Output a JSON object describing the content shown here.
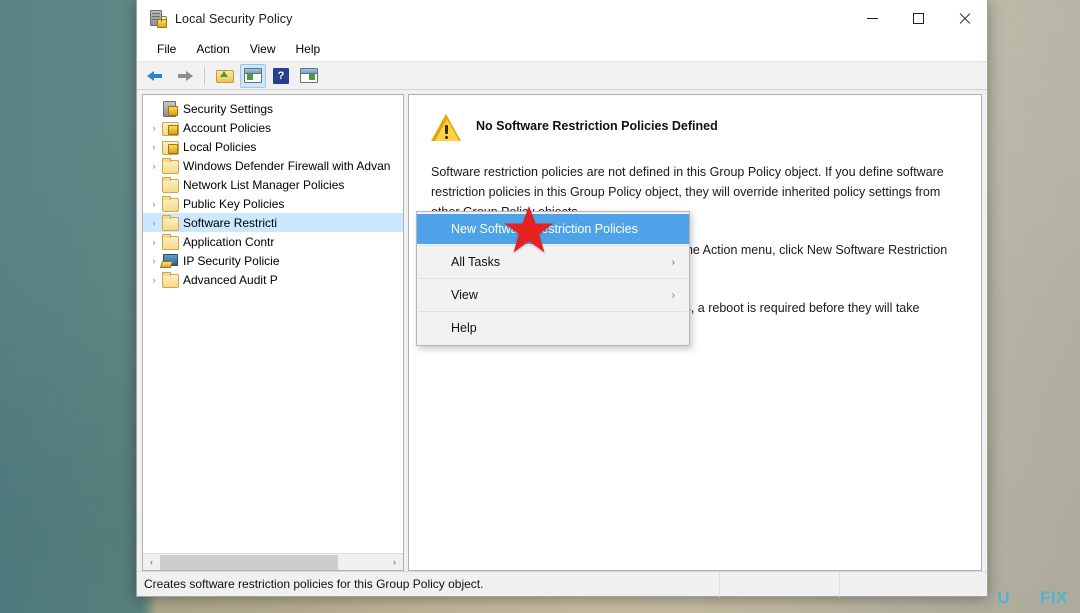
{
  "window": {
    "title": "Local Security Policy",
    "icon": "security-policy-icon",
    "controls": {
      "minimize": "—",
      "maximize": "□",
      "close": "✕"
    }
  },
  "menubar": {
    "items": [
      "File",
      "Action",
      "View",
      "Help"
    ]
  },
  "toolbar": {
    "buttons": [
      {
        "name": "back-button",
        "icon": "arrow-left-icon"
      },
      {
        "name": "forward-button",
        "icon": "arrow-right-icon"
      },
      {
        "name": "up-one-level-button",
        "icon": "folder-up-icon"
      },
      {
        "name": "show-hide-console-tree-button",
        "icon": "console-tree-icon",
        "active": true
      },
      {
        "name": "help-button",
        "icon": "question-mark-icon"
      },
      {
        "name": "show-hide-action-pane-button",
        "icon": "action-pane-icon"
      }
    ]
  },
  "tree": {
    "nodes": [
      {
        "label": "Security Settings",
        "icon": "security-settings-icon",
        "depth": 0,
        "expander": "none",
        "selected": false
      },
      {
        "label": "Account Policies",
        "icon": "folder-lock-icon",
        "depth": 1,
        "expander": "collapsed",
        "selected": false
      },
      {
        "label": "Local Policies",
        "icon": "folder-lock-icon",
        "depth": 1,
        "expander": "collapsed",
        "selected": false
      },
      {
        "label": "Windows Defender Firewall with Advan",
        "icon": "folder-icon",
        "depth": 1,
        "expander": "collapsed",
        "selected": false
      },
      {
        "label": "Network List Manager Policies",
        "icon": "folder-icon",
        "depth": 1,
        "expander": "none",
        "selected": false
      },
      {
        "label": "Public Key Policies",
        "icon": "folder-icon",
        "depth": 1,
        "expander": "collapsed",
        "selected": false
      },
      {
        "label": "Software Restricti",
        "icon": "folder-icon",
        "depth": 1,
        "expander": "collapsed",
        "selected": true
      },
      {
        "label": "Application Contr",
        "icon": "folder-icon",
        "depth": 1,
        "expander": "collapsed",
        "selected": false
      },
      {
        "label": "IP Security Policie",
        "icon": "ip-security-icon",
        "depth": 1,
        "expander": "collapsed",
        "selected": false
      },
      {
        "label": "Advanced Audit P",
        "icon": "folder-icon",
        "depth": 1,
        "expander": "collapsed",
        "selected": false
      }
    ],
    "hscroll": {
      "left_arrow": "‹",
      "right_arrow": "›"
    }
  },
  "details": {
    "heading": "No Software Restriction Policies Defined",
    "heading_icon": "warning-triangle-icon",
    "paragraph1": "Software restriction policies are not defined in this Group Policy object. If you define software restriction policies in this Group Policy object, they will override inherited policy settings from other Group Policy objects.",
    "paragraph2": "To create new software restriction policies, in the Action menu, click New Software Restriction Policies.",
    "paragraph3": "Note: After deleting software restriction policies, a reboot is required before they will take effect."
  },
  "context_menu": {
    "items": [
      {
        "label": "New Software Restriction Policies",
        "submenu": false,
        "highlighted": true
      },
      {
        "label": "All Tasks",
        "submenu": true,
        "highlighted": false
      },
      {
        "label": "View",
        "submenu": true,
        "highlighted": false
      },
      {
        "label": "Help",
        "submenu": false,
        "highlighted": false
      }
    ],
    "submenu_arrow": "›"
  },
  "statusbar": {
    "text": "Creates software restriction policies for this Group Policy object."
  },
  "watermark": {
    "left": "U",
    "right": "FIX"
  },
  "colors": {
    "selection_blue": "#cce8ff",
    "menu_highlight": "#4ea3e8",
    "pointer_red": "#e8201f",
    "warning_yellow": "#ffd24a",
    "watermark_blue": "#4ab3d6"
  }
}
